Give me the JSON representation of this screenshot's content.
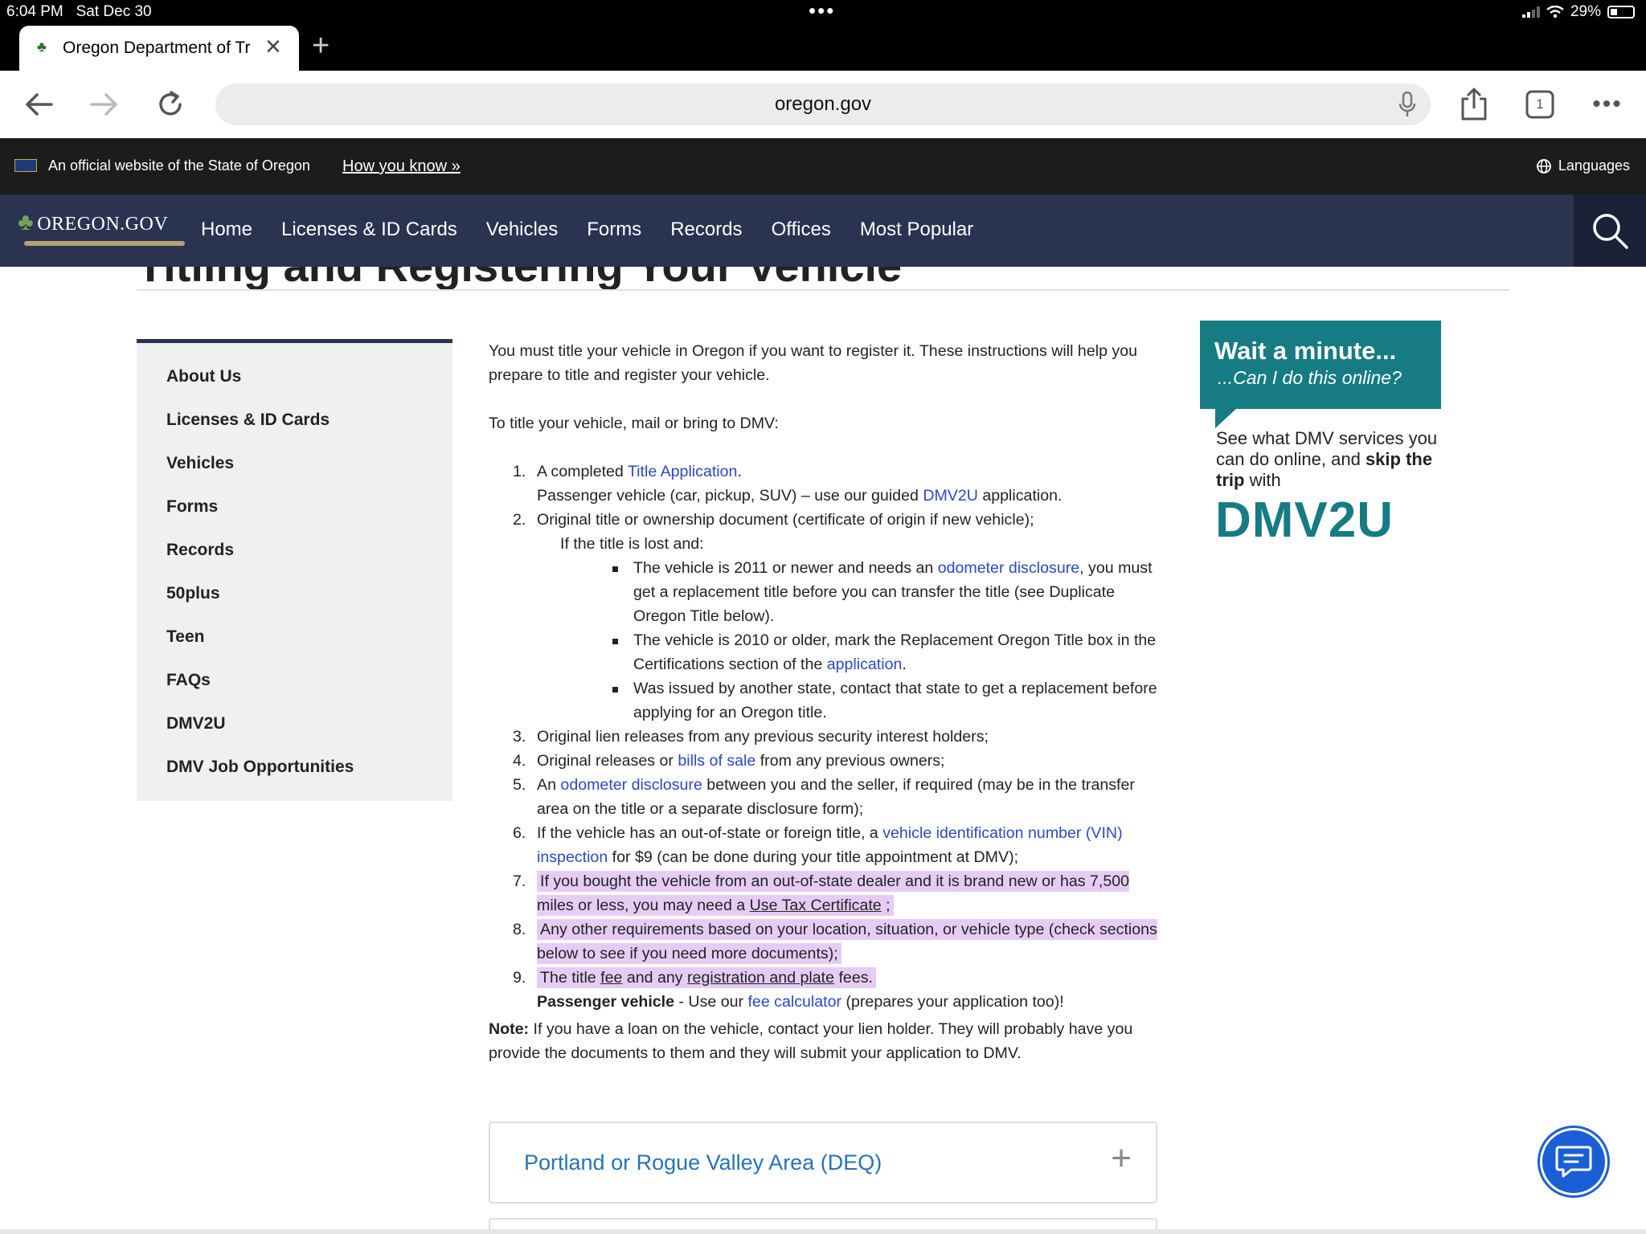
{
  "status": {
    "time": "6:04 PM",
    "date": "Sat Dec 30",
    "battery": "29%"
  },
  "tab": {
    "title": "Oregon Department of Tr"
  },
  "toolbar": {
    "url": "oregon.gov",
    "tab_count": "1"
  },
  "gov_banner": {
    "official": "An official website of the State of Oregon",
    "how": "How you know »",
    "languages": "Languages"
  },
  "nav": {
    "logo": "OREGON.GOV",
    "links": [
      "Home",
      "Licenses & ID Cards",
      "Vehicles",
      "Forms",
      "Records",
      "Offices",
      "Most Popular"
    ]
  },
  "page": {
    "heading": "Titling and Registering Your Vehicle"
  },
  "sidebar": {
    "items": [
      "About Us",
      "Licenses & ID Cards",
      "Vehicles",
      "Forms",
      "Records",
      "50plus",
      "Teen",
      "FAQs",
      "DMV2U",
      "DMV Job Opportunities"
    ]
  },
  "content": {
    "intro": "You must title your vehicle in Oregon if you want to register it.  These instructions will help you prepare to title and register your vehicle.",
    "lead": "To title your vehicle, mail or bring to DMV:",
    "i1a": "A completed ",
    "i1_link": "Title Application",
    "i1b": ".",
    "i1c": "Passenger vehicle (car, pickup, SUV) – use our guided ",
    "i1_link2": "DMV2U",
    "i1d": " application.",
    "i2": "Original title or ownership document (certificate of origin if new vehicle);",
    "i2_sub": "If the title is lost and:",
    "b1a": "The vehicle is 2011 or newer and needs an ",
    "b1_link": "odometer disclosure",
    "b1b": ", you must get a replacement title before you can transfer the title (see Duplicate Oregon Title below).",
    "b2a": "The vehicle is 2010 or older, mark the Replacement Oregon Title box in the Certifications section of the ",
    "b2_link": "application",
    "b2b": ".",
    "b3": "Was issued by another state, contact that state to get a replacement before applying for an Oregon title.",
    "i3": "Original lien releases from any previous security interest holders;",
    "i4a": "Original releases or ",
    "i4_link": "bills of sale",
    "i4b": " from any previous owners;",
    "i5a": "An ",
    "i5_link": "odometer disclosure",
    "i5b": " between you and the seller, if required (may be in the transfer area on the title or a separate disclosure form);",
    "i6a": "If the vehicle has an out-of-state or foreign title, a ",
    "i6_link": "vehicle identification number (VIN) inspection",
    "i6b": " for $9 (can be done during your title appointment at DMV);",
    "i7a": "If you bought the vehicle from an out-of-state dealer and it is brand new or has 7,500 miles or less, you may need a ",
    "i7_link": "Use Tax Certificate",
    "i7b": " ;",
    "i8": "Any other requirements based on your location, situation, or vehicle type (check sections below to see if you need more documents);",
    "i9a": "The title ",
    "i9_link": "fee",
    "i9b": " and any ",
    "i9_link2": "registration and plate",
    "i9c": " fees.",
    "i9d_bold": "Passenger vehicle",
    "i9d": " - Use our ",
    "i9_link3": "fee calculator",
    "i9e": " (prepares your application too)!",
    "note_bold": "Note:",
    "note": " If you have a loan on the vehicle, contact your lien holder.  They will probably have you provide the documents to them and they will submit your application to DMV."
  },
  "promo": {
    "title": "Wait a minute...",
    "subtitle": "...Can I do this online?",
    "desc1": "See what DMV services you can do online, and ",
    "desc_bold": "skip the trip",
    "desc2": " with",
    "logo": "DMV2U"
  },
  "accordion": {
    "title": "Portland or Rogue Valley Area (DEQ)"
  }
}
